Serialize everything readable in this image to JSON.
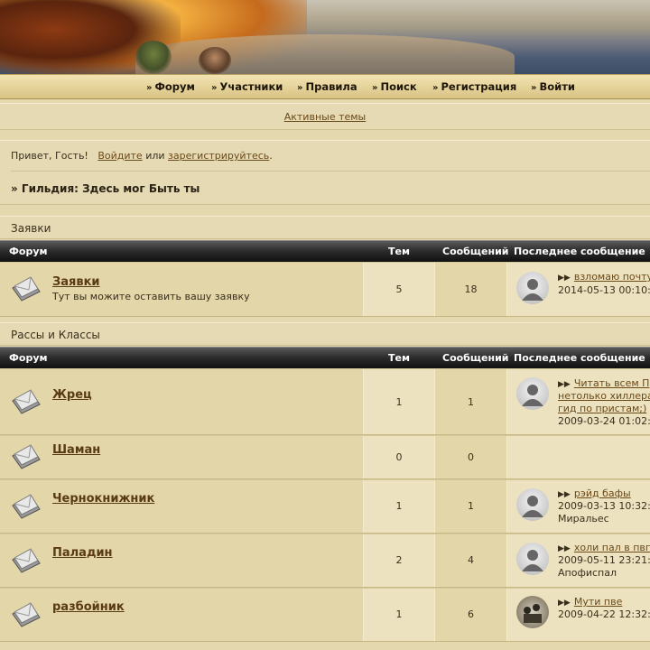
{
  "nav": {
    "items": [
      {
        "label": "Форум"
      },
      {
        "label": "Участники"
      },
      {
        "label": "Правила"
      },
      {
        "label": "Поиск"
      },
      {
        "label": "Регистрация"
      },
      {
        "label": "Войти"
      }
    ],
    "arrow": "»"
  },
  "active_topics": "Активные темы",
  "greeting": {
    "prefix": "Привет, Гость!",
    "login": "Войдите",
    "or": "или",
    "register": "зарегистрируйтесь",
    "suffix": ".",
    "guild": "» Гильдия: Здесь мог Быть ты"
  },
  "columns": {
    "forum": "Форум",
    "topics": "Тем",
    "posts": "Сообщений",
    "last": "Последнее сообщение"
  },
  "categories": [
    {
      "title": "Заявки",
      "forums": [
        {
          "name": "Заявки",
          "desc": "Тут вы можите оставить вашу заявку",
          "topics": "5",
          "posts": "18",
          "last": {
            "link": "взломаю почту",
            "lines": [
              "2014-05-13 00:10:"
            ]
          }
        }
      ]
    },
    {
      "title": "Рассы и Классы",
      "forums": [
        {
          "name": "Жрец",
          "topics": "1",
          "posts": "1",
          "last": {
            "link": "Читать всем П",
            "lines": [
              "нетолько хиллера",
              "гид по пристам;)",
              "2009-03-24 01:02:"
            ],
            "link_lines": 3
          }
        },
        {
          "name": "Шаман",
          "topics": "0",
          "posts": "0"
        },
        {
          "name": "Чернокнижник",
          "topics": "1",
          "posts": "1",
          "last": {
            "link": "рэйд бафы",
            "lines": [
              "2009-03-13 10:32:",
              "Миральес"
            ]
          }
        },
        {
          "name": "Паладин",
          "topics": "2",
          "posts": "4",
          "last": {
            "link": "холи пал в пвп",
            "lines": [
              "2009-05-11 23:21:",
              "Апофиспал"
            ]
          }
        },
        {
          "name": "разбойник",
          "topics": "1",
          "posts": "6",
          "last": {
            "link": "Мути пве",
            "lines": [
              "2009-04-22 12:32:"
            ]
          }
        }
      ]
    }
  ]
}
